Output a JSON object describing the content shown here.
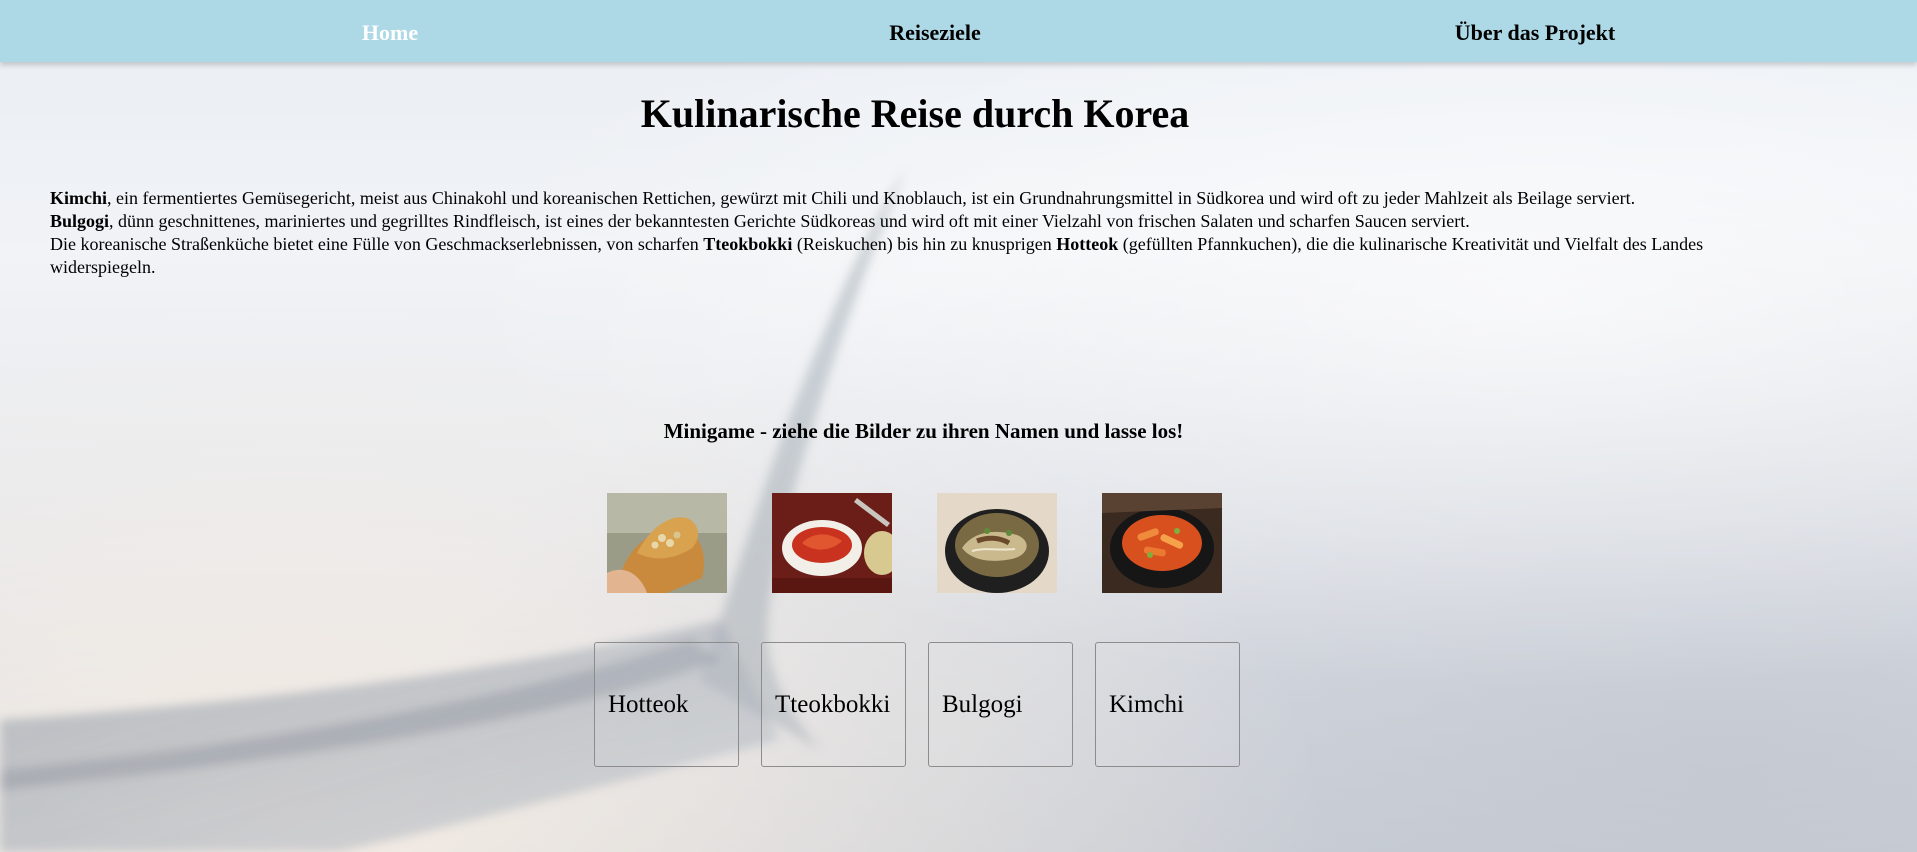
{
  "nav": {
    "home": "Home",
    "reiseziele": "Reiseziele",
    "projekt": "Über das Projekt"
  },
  "title": "Kulinarische Reise durch Korea",
  "intro": {
    "kimchi_bold": "Kimchi",
    "kimchi_text": ", ein fermentiertes Gemüsegericht, meist aus Chinakohl und koreanischen Rettichen, gewürzt mit Chili und Knoblauch, ist ein Grundnahrungsmittel in Südkorea und wird oft zu jeder Mahlzeit als Beilage serviert.",
    "bulgogi_bold": "Bulgogi",
    "bulgogi_text": ", dünn geschnittenes, mariniertes und gegrilltes Rindfleisch, ist eines der bekanntesten Gerichte Südkoreas und wird oft mit einer Vielzahl von frischen Salaten und scharfen Saucen serviert.",
    "street_text_1": "Die koreanische Straßenküche bietet eine Fülle von Geschmackserlebnissen, von scharfen ",
    "tteokbokki_bold": "Tteokbokki",
    "street_text_2": " (Reiskuchen) bis hin zu knusprigen ",
    "hotteok_bold": "Hotteok",
    "street_text_3": " (gefüllten Pfannkuchen), die die kulinarische Kreativität und Vielfalt des Landes widerspiegeln."
  },
  "minigame": {
    "heading": "Minigame - ziehe die Bilder zu ihren Namen und lasse los!",
    "images": [
      "hotteok-photo",
      "kimchi-photo",
      "bulgogi-photo",
      "tteokbokki-photo"
    ],
    "drop_zones": [
      "Hotteok",
      "Tteokbokki",
      "Bulgogi",
      "Kimchi"
    ]
  },
  "colors": {
    "nav_background": "#add8e6",
    "nav_active_text": "#ffffff"
  }
}
